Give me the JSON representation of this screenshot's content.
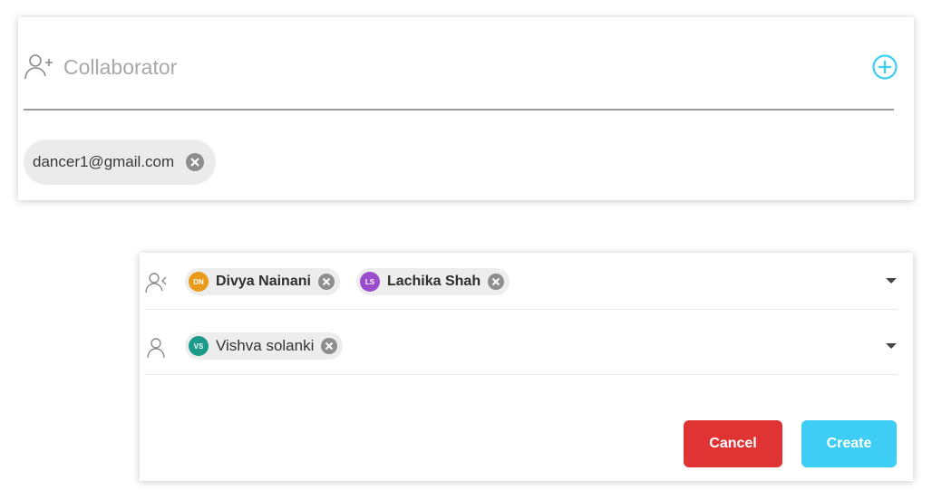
{
  "collaborator": {
    "placeholder": "Collaborator",
    "chips": [
      {
        "label": "dancer1@gmail.com"
      }
    ]
  },
  "assignees": {
    "row1": [
      {
        "initials": "DN",
        "name": "Divya Nainani",
        "color": "#e89a1b"
      },
      {
        "initials": "LS",
        "name": "Lachika Shah",
        "color": "#9b4ccd"
      }
    ],
    "row2": [
      {
        "initials": "VS",
        "name": "Vishva solanki",
        "color": "#1a9a8a"
      }
    ]
  },
  "actions": {
    "cancel_label": "Cancel",
    "create_label": "Create"
  },
  "colors": {
    "accent": "#3dcdf5",
    "danger": "#e03434"
  },
  "icons": [
    "person-add-icon",
    "add-circle-icon",
    "chip-close-icon",
    "people-icon",
    "person-icon",
    "dropdown-arrow-icon"
  ]
}
